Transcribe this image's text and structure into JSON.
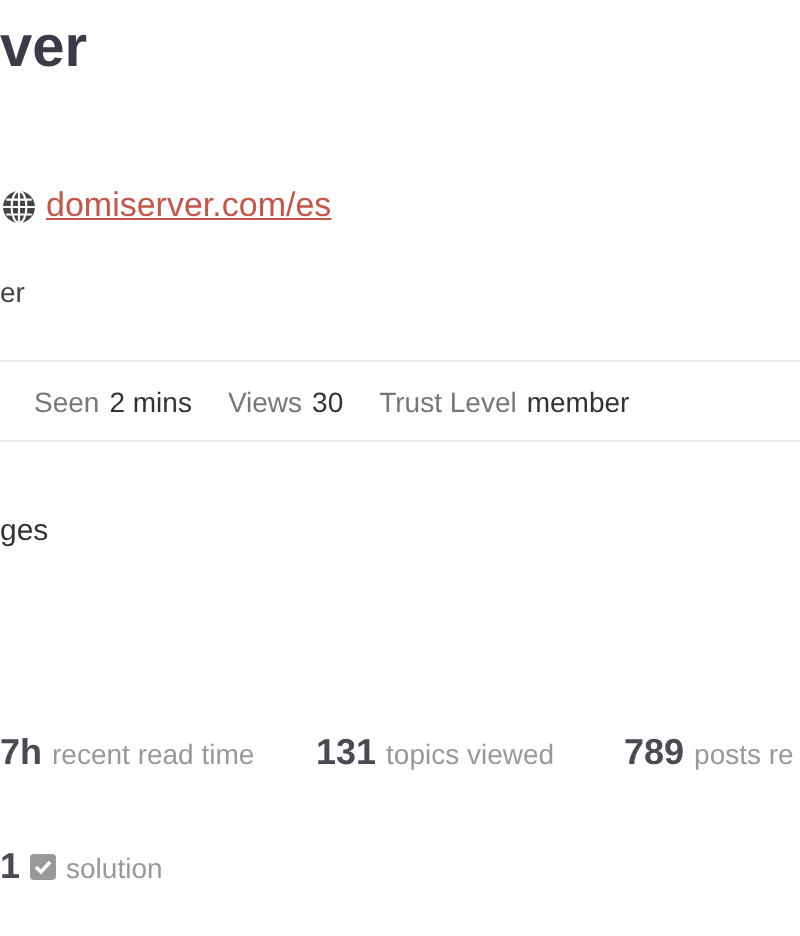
{
  "header": {
    "title": "ver",
    "website": "domiserver.com/es",
    "bio": "er"
  },
  "info": [
    {
      "label": "Seen",
      "value": "2 mins"
    },
    {
      "label": "Views",
      "value": "30"
    },
    {
      "label": "Trust Level",
      "value": "member"
    }
  ],
  "section_title": "ges",
  "stats": [
    {
      "value": "7h",
      "label": "recent read time"
    },
    {
      "value": "131",
      "label": "topics viewed"
    },
    {
      "value": "789",
      "label": "posts re"
    }
  ],
  "solutions": {
    "value": "1",
    "label": "solution"
  }
}
